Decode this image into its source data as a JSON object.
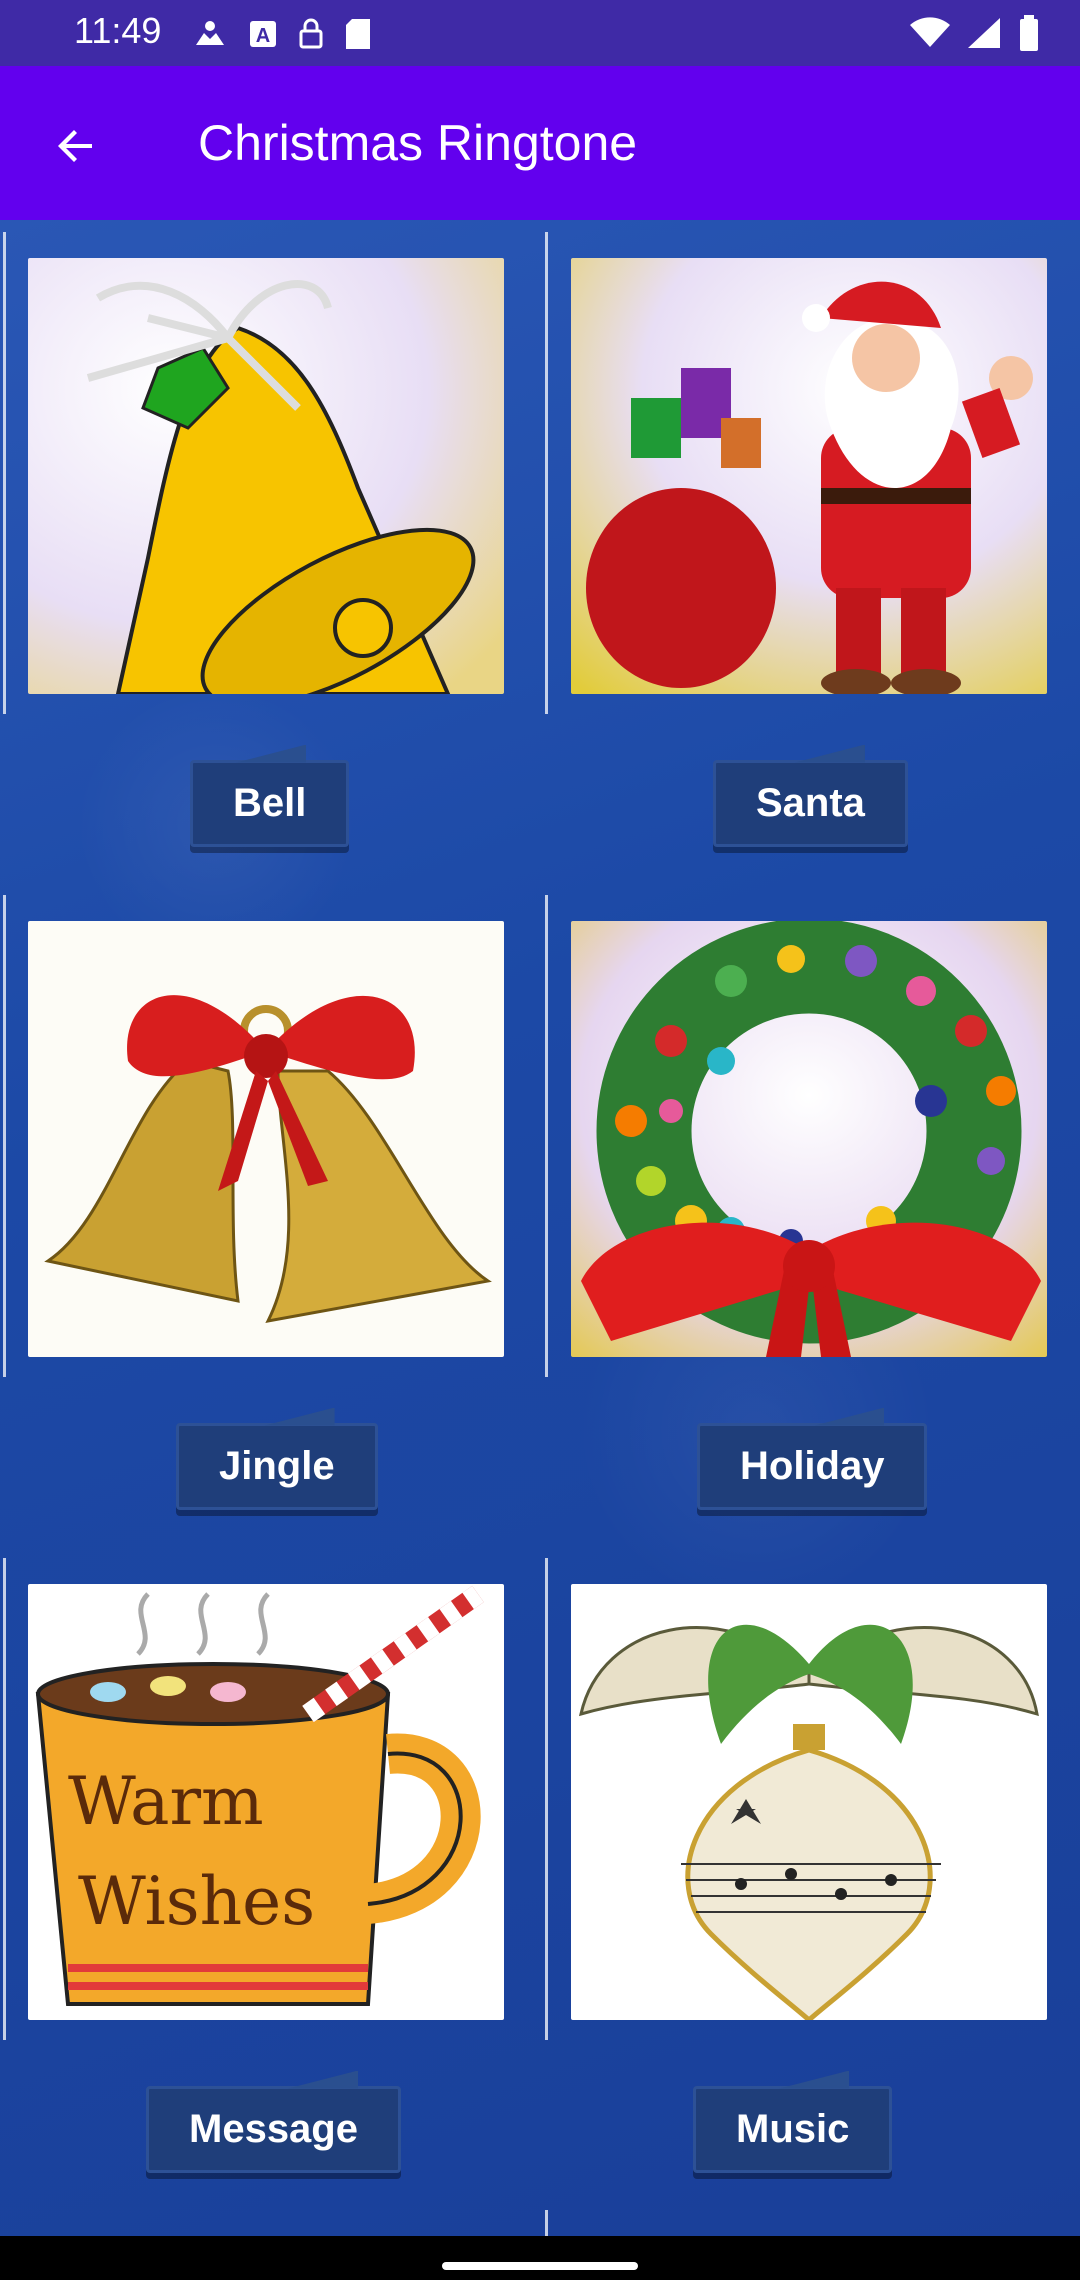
{
  "status": {
    "time": "11:49"
  },
  "app_bar": {
    "title": "Christmas Ringtone"
  },
  "ringtones": [
    {
      "label": "Bell"
    },
    {
      "label": "Santa"
    },
    {
      "label": "Jingle"
    },
    {
      "label": "Holiday"
    },
    {
      "label": "Message"
    },
    {
      "label": "Music"
    }
  ],
  "thumb_text": {
    "warm": "Warm",
    "wishes": "Wishes"
  },
  "colors": {
    "status_bar": "#3f2aa6",
    "app_bar": "#6200ee",
    "background": "#1c4aa3",
    "button": "#1f3e7a"
  }
}
